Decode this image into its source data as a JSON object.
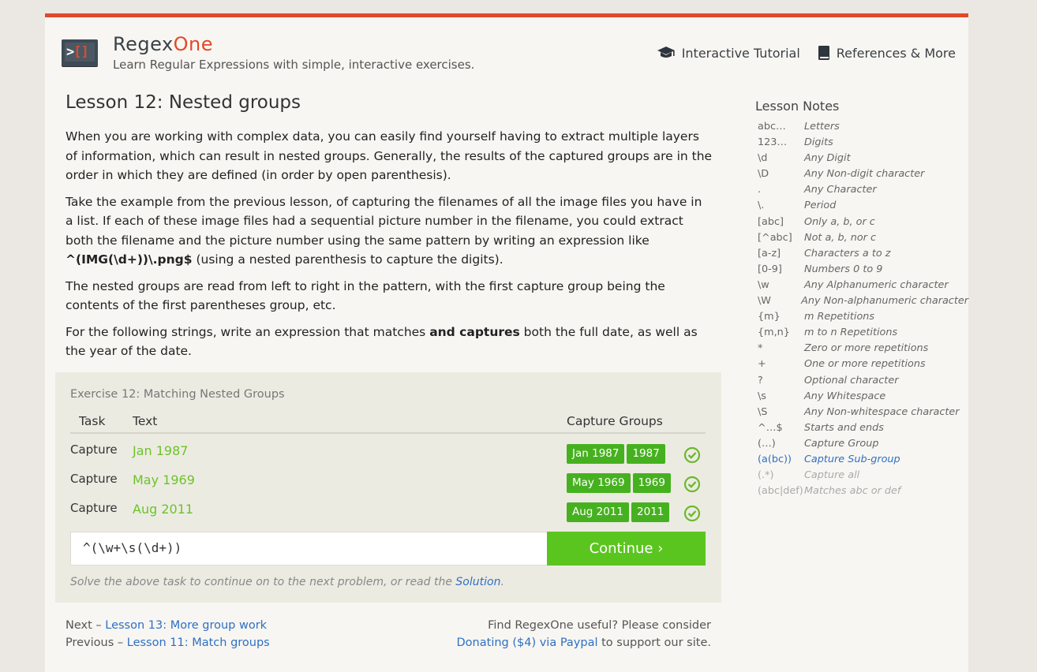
{
  "header": {
    "brand_main": "Regex",
    "brand_accent": "One",
    "tagline": "Learn Regular Expressions with simple, interactive exercises.",
    "logo_glyph_left": ">",
    "logo_glyph_right": "[]",
    "nav": [
      {
        "label": "Interactive Tutorial",
        "icon": "graduation-cap-icon"
      },
      {
        "label": "References & More",
        "icon": "book-icon"
      }
    ]
  },
  "lesson": {
    "title": "Lesson 12: Nested groups",
    "p1": "When you are working with complex data, you can easily find yourself having to extract multiple layers of information, which can result in nested groups. Generally, the results of the captured groups are in the order in which they are defined (in order by open parenthesis).",
    "p2_before": "Take the example from the previous lesson, of capturing the filenames of all the image files you have in a list. If each of these image files had a sequential picture number in the filename, you could extract both the filename and the picture number using the same pattern by writing an expression like ",
    "p2_code": "^(IMG(\\d+))\\.png$",
    "p2_after": " (using a nested parenthesis to capture the digits).",
    "p3": "The nested groups are read from left to right in the pattern, with the first capture group being the contents of the first parentheses group, etc.",
    "p4_before": "For the following strings, write an expression that matches ",
    "p4_bold": "and captures",
    "p4_after": " both the full date, as well as the year of the date."
  },
  "exercise": {
    "title": "Exercise 12: Matching Nested Groups",
    "col_task": "Task",
    "col_text": "Text",
    "col_groups": "Capture Groups",
    "rows": [
      {
        "task": "Capture",
        "text": "Jan 1987",
        "groups": [
          "Jan 1987",
          "1987"
        ]
      },
      {
        "task": "Capture",
        "text": "May 1969",
        "groups": [
          "May 1969",
          "1969"
        ]
      },
      {
        "task": "Capture",
        "text": "Aug 2011",
        "groups": [
          "Aug 2011",
          "2011"
        ]
      }
    ],
    "input_value": "^(\\w+\\s(\\d+))",
    "continue_label": "Continue ›",
    "hint_before": "Solve the above task to continue on to the next problem, or read the ",
    "hint_link": "Solution",
    "hint_after": "."
  },
  "footer": {
    "next_prefix": "Next – ",
    "next_link": "Lesson 13: More group work",
    "prev_prefix": "Previous – ",
    "prev_link": "Lesson 11: Match groups",
    "support_line": "Find RegexOne useful? Please consider",
    "donate_link": "Donating ($4) via Paypal",
    "donate_after": " to support our site."
  },
  "sidebar": {
    "title": "Lesson Notes",
    "notes": [
      {
        "k": "abc…",
        "v": "Letters"
      },
      {
        "k": "123…",
        "v": "Digits"
      },
      {
        "k": "\\d",
        "v": "Any Digit"
      },
      {
        "k": "\\D",
        "v": "Any Non-digit character"
      },
      {
        "k": ".",
        "v": "Any Character"
      },
      {
        "k": "\\.",
        "v": "Period"
      },
      {
        "k": "[abc]",
        "v": "Only a, b, or c"
      },
      {
        "k": "[^abc]",
        "v": "Not a, b, nor c"
      },
      {
        "k": "[a-z]",
        "v": "Characters a to z"
      },
      {
        "k": "[0-9]",
        "v": "Numbers 0 to 9"
      },
      {
        "k": "\\w",
        "v": "Any Alphanumeric character"
      },
      {
        "k": "\\W",
        "v": "Any Non-alphanumeric character"
      },
      {
        "k": "{m}",
        "v": "m Repetitions"
      },
      {
        "k": "{m,n}",
        "v": "m to n Repetitions"
      },
      {
        "k": "*",
        "v": "Zero or more repetitions"
      },
      {
        "k": "+",
        "v": "One or more repetitions"
      },
      {
        "k": "?",
        "v": "Optional character"
      },
      {
        "k": "\\s",
        "v": "Any Whitespace"
      },
      {
        "k": "\\S",
        "v": "Any Non-whitespace character"
      },
      {
        "k": "^…$",
        "v": "Starts and ends"
      },
      {
        "k": "(…)",
        "v": "Capture Group"
      },
      {
        "k": "(a(bc))",
        "v": "Capture Sub-group"
      },
      {
        "k": "(.*)",
        "v": "Capture all"
      },
      {
        "k": "(abc|def)",
        "v": "Matches abc or def"
      }
    ]
  },
  "colors": {
    "accent": "#e0492a",
    "success": "#46b11f",
    "continue": "#5bc51f",
    "link": "#2f6fc4"
  }
}
